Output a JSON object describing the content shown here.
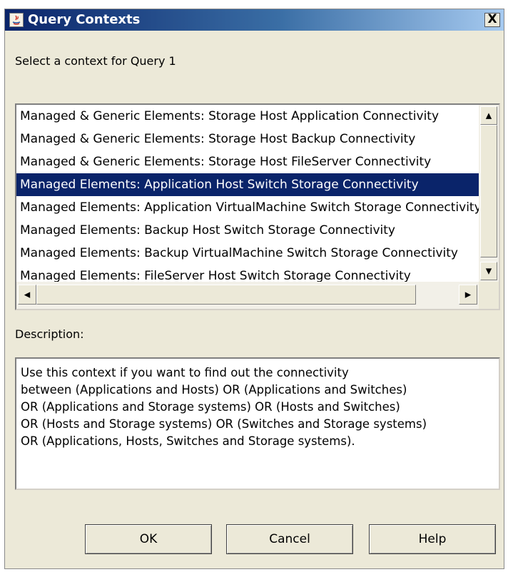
{
  "window": {
    "title": "Query Contexts",
    "close_label": "X"
  },
  "prompt": "Select a context for Query 1",
  "contexts": {
    "items": [
      "Managed & Generic Elements: Storage Host Application Connectivity",
      "Managed & Generic Elements: Storage Host Backup Connectivity",
      "Managed & Generic Elements: Storage Host FileServer Connectivity",
      "Managed Elements: Application Host Switch Storage Connectivity",
      "Managed Elements: Application VirtualMachine Switch Storage Connectivity",
      "Managed Elements: Backup Host Switch Storage Connectivity",
      "Managed Elements: Backup VirtualMachine Switch Storage Connectivity",
      "Managed Elements: FileServer Host Switch Storage Connectivity"
    ],
    "selected_index": 3
  },
  "description": {
    "label": "Description:",
    "lines": [
      "Use this context if you want to find out the connectivity",
      "between (Applications and Hosts) OR (Applications and Switches)",
      "OR (Applications and Storage systems) OR (Hosts and Switches)",
      "OR (Hosts and Storage systems) OR (Switches and Storage systems)",
      "OR (Applications, Hosts, Switches and Storage systems)."
    ]
  },
  "buttons": {
    "ok": "OK",
    "cancel": "Cancel",
    "help": "Help"
  },
  "colors": {
    "selection": "#0a246a",
    "title_bar": "#0a246a",
    "dialog_bg": "#ece9d8"
  }
}
